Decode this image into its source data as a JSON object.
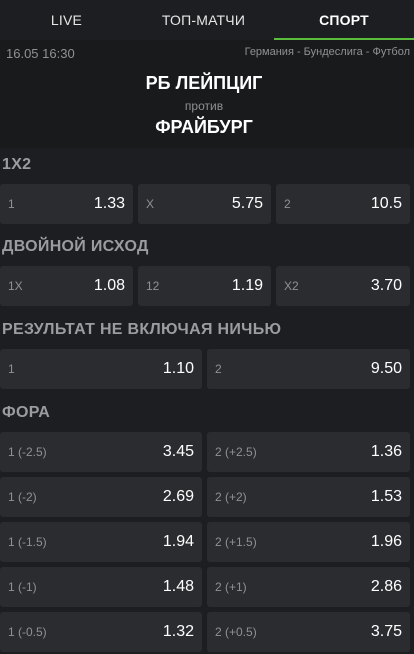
{
  "tabs": [
    "LIVE",
    "ТОП-МАТЧИ",
    "СПОРТ"
  ],
  "match": {
    "datetime": "16.05 16:30",
    "league": "Германия - Бундеслига - Футбол",
    "home": "РБ ЛЕЙПЦИГ",
    "vs": "против",
    "away": "ФРАЙБУРГ"
  },
  "markets": {
    "m1x2": {
      "title": "1X2",
      "options": [
        {
          "label": "1",
          "odds": "1.33"
        },
        {
          "label": "X",
          "odds": "5.75"
        },
        {
          "label": "2",
          "odds": "10.5"
        }
      ]
    },
    "double": {
      "title": "ДВОЙНОЙ ИСХОД",
      "options": [
        {
          "label": "1X",
          "odds": "1.08"
        },
        {
          "label": "12",
          "odds": "1.19"
        },
        {
          "label": "X2",
          "odds": "3.70"
        }
      ]
    },
    "dnb": {
      "title": "РЕЗУЛЬТАТ НЕ ВКЛЮЧАЯ НИЧЬЮ",
      "options": [
        {
          "label": "1",
          "odds": "1.10"
        },
        {
          "label": "2",
          "odds": "9.50"
        }
      ]
    },
    "handicap": {
      "title": "ФОРА",
      "rows": [
        [
          {
            "label": "1 (-2.5)",
            "odds": "3.45"
          },
          {
            "label": "2 (+2.5)",
            "odds": "1.36"
          }
        ],
        [
          {
            "label": "1 (-2)",
            "odds": "2.69"
          },
          {
            "label": "2 (+2)",
            "odds": "1.53"
          }
        ],
        [
          {
            "label": "1 (-1.5)",
            "odds": "1.94"
          },
          {
            "label": "2 (+1.5)",
            "odds": "1.96"
          }
        ],
        [
          {
            "label": "1 (-1)",
            "odds": "1.48"
          },
          {
            "label": "2 (+1)",
            "odds": "2.86"
          }
        ],
        [
          {
            "label": "1 (-0.5)",
            "odds": "1.32"
          },
          {
            "label": "2 (+0.5)",
            "odds": "3.75"
          }
        ]
      ]
    }
  },
  "colors": {
    "accent": "#5abd3c",
    "background": "#1d1e22",
    "cell": "#2a2c30"
  }
}
